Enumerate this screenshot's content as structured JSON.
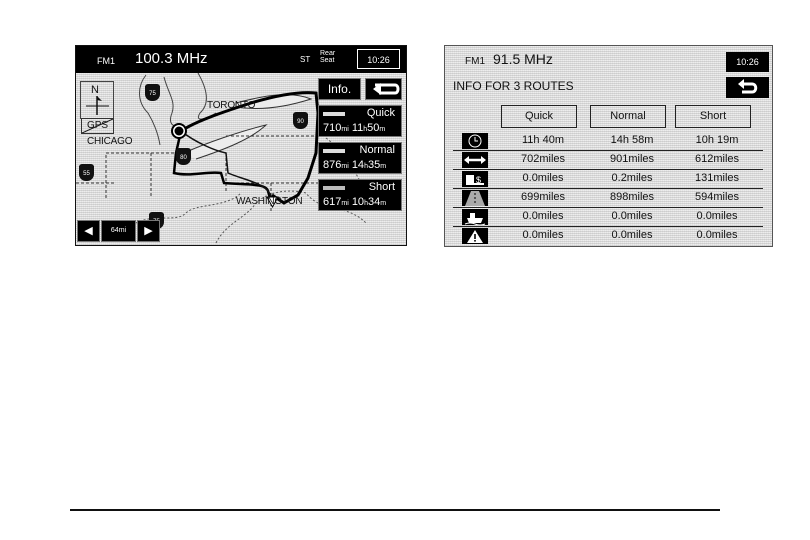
{
  "map_screen": {
    "radio": {
      "band": "FM1",
      "frequency": "100.3 MHz",
      "stereo": "ST",
      "rear_seat": "Rear Seat"
    },
    "clock": "10:26",
    "compass_label": "N",
    "gps_label": "GPS",
    "city_labels": {
      "toronto": "TORONTO",
      "chicago": "CHICAGO",
      "washington": "WASHINGTON"
    },
    "highway_shields": {
      "i75_north": "75",
      "i90_east": "90",
      "i80": "80",
      "i55": "55",
      "i75_south": "75"
    },
    "info_button": "Info.",
    "back_icon": "back-arrow-icon",
    "routes": [
      {
        "name": "Quick",
        "distance": "710",
        "distance_unit": "mi",
        "hours": "11",
        "hours_unit": "h",
        "minutes": "50",
        "minutes_unit": "m"
      },
      {
        "name": "Normal",
        "distance": "876",
        "distance_unit": "mi",
        "hours": "14",
        "hours_unit": "h",
        "minutes": "35",
        "minutes_unit": "m"
      },
      {
        "name": "Short",
        "distance": "617",
        "distance_unit": "mi",
        "hours": "10",
        "hours_unit": "h",
        "minutes": "34",
        "minutes_unit": "m"
      }
    ],
    "zoom": {
      "scale": "64mi",
      "zoom_out_icon": "left-arrow-icon",
      "zoom_in_icon": "right-arrow-icon"
    }
  },
  "info_screen": {
    "radio": {
      "band": "FM1",
      "frequency": "91.5 MHz"
    },
    "clock": "10:26",
    "title": "INFO FOR 3 ROUTES",
    "columns": [
      "Quick",
      "Normal",
      "Short"
    ],
    "rows": [
      {
        "icon": "clock-icon",
        "values": [
          "11h 40m",
          "14h 58m",
          "10h 19m"
        ]
      },
      {
        "icon": "distance-arrow-icon",
        "values": [
          "702miles",
          "901miles",
          "612miles"
        ]
      },
      {
        "icon": "toll-road-icon",
        "values": [
          "0.0miles",
          "0.2miles",
          "131miles"
        ]
      },
      {
        "icon": "freeway-icon",
        "values": [
          "699miles",
          "898miles",
          "594miles"
        ]
      },
      {
        "icon": "ferry-icon",
        "values": [
          "0.0miles",
          "0.0miles",
          "0.0miles"
        ]
      },
      {
        "icon": "warning-icon",
        "values": [
          "0.0miles",
          "0.0miles",
          "0.0miles"
        ]
      }
    ]
  }
}
